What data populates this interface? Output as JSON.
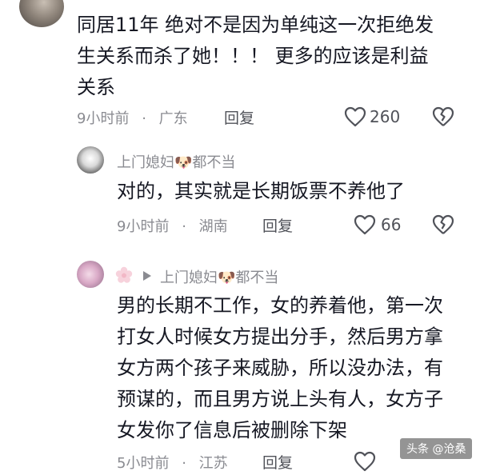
{
  "comments": [
    {
      "text_lines": [
        "同居11年 绝对不是因为单纯这一次拒绝发",
        "生关系而杀了她！！！ 更多的应该是利益",
        "关系"
      ],
      "time": "9小时前",
      "location": "广东",
      "reply_label": "回复",
      "likes": "260"
    },
    {
      "username": "上门媳妇🐶都不当",
      "text": "对的，其实就是长期饭票不养他了",
      "time": "9小时前",
      "location": "湖南",
      "reply_label": "回复",
      "likes": "66"
    },
    {
      "reply_to": "上门媳妇🐶都不当",
      "text_lines": [
        "男的长期不工作，女的养着他，第一次",
        "打女人时候女方提出分手，然后男方拿",
        "女方两个孩子来威胁，所以没办法，有",
        "预谋的，而且男方说上头有人，女方子",
        "女发你了信息后被删除下架"
      ],
      "time": "5小时前",
      "location": "江苏",
      "reply_label": "回复"
    }
  ],
  "separator": "·",
  "watermark": "头条 @沧桑",
  "icons": {
    "like": "heart-outline-icon",
    "dislike": "broken-heart-icon",
    "reply_arrow": "play-arrow-icon",
    "flower": "flower-badge-icon"
  }
}
